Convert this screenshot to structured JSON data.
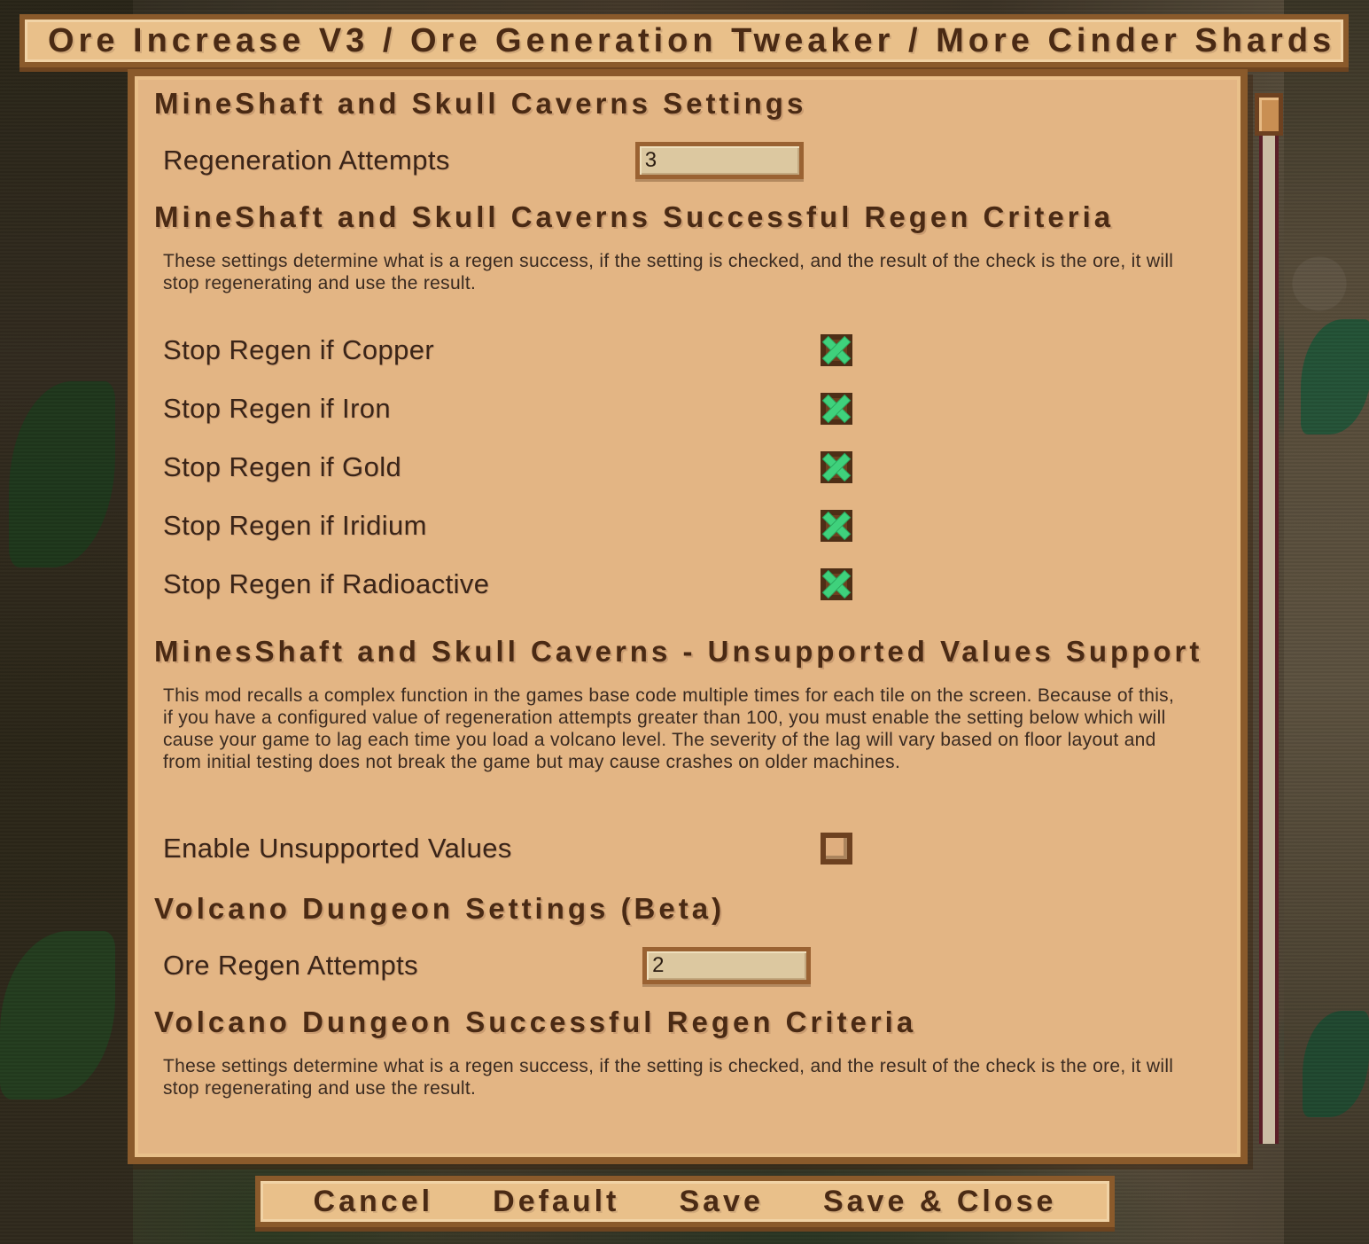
{
  "window": {
    "title": "Ore Increase V3 / Ore Generation Tweaker / More Cinder Shards"
  },
  "sections": {
    "mineshaft_settings": {
      "heading": "MineShaft and Skull Caverns Settings",
      "regen_attempts_label": "Regeneration Attempts",
      "regen_attempts_value": "3"
    },
    "mineshaft_criteria": {
      "heading": "MineShaft and Skull Caverns Successful Regen Criteria",
      "description": "These settings determine what is a regen success, if the setting is checked, and the result of the check is the ore, it will stop regenerating and use the result.",
      "options": [
        {
          "label": "Stop Regen if Copper",
          "checked": true
        },
        {
          "label": "Stop Regen if Iron",
          "checked": true
        },
        {
          "label": "Stop Regen if Gold",
          "checked": true
        },
        {
          "label": "Stop Regen if Iridium",
          "checked": true
        },
        {
          "label": "Stop Regen if Radioactive",
          "checked": true
        }
      ]
    },
    "unsupported_values": {
      "heading": "MinesShaft and Skull Caverns - Unsupported Values Support",
      "description": "This mod recalls a complex function in the games base code multiple times for each tile on the screen. Because of this, if you have a configured value of regeneration attempts greater than 100, you must enable the setting below which will cause your game to lag each time you load a volcano level. The severity of the lag will vary based on floor layout and from initial testing does not break the game but may cause crashes on older machines.",
      "enable_label": "Enable Unsupported Values",
      "enable_checked": false
    },
    "volcano_settings": {
      "heading": "Volcano Dungeon Settings (Beta)",
      "ore_regen_label": "Ore Regen Attempts",
      "ore_regen_value": "2"
    },
    "volcano_criteria": {
      "heading": "Volcano Dungeon Successful Regen Criteria",
      "description": "These settings determine what is a regen success, if the setting is checked, and the result of the check is the ore, it will stop regenerating and use the result."
    }
  },
  "buttons": {
    "cancel": "Cancel",
    "default": "Default",
    "save": "Save",
    "save_close": "Save & Close"
  },
  "colors": {
    "panel_bg": "#e3b584",
    "panel_border": "#8a5a2b",
    "title_bg": "#e9c08a",
    "text_dark": "#4a2a14",
    "checkbox_green": "#3fd17c"
  }
}
